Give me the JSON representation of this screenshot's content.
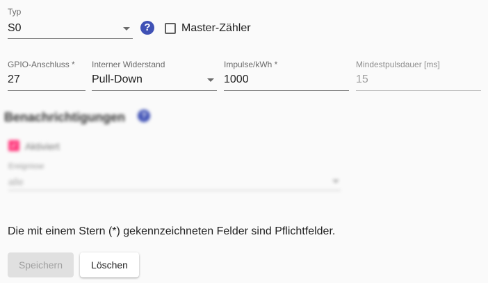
{
  "typ": {
    "label": "Typ",
    "value": "S0"
  },
  "help_icon": "?",
  "master": {
    "label": "Master-Zähler",
    "checked": false
  },
  "gpio": {
    "label": "GPIO-Anschluss *",
    "value": "27"
  },
  "widerstand": {
    "label": "Interner Widerstand",
    "value": "Pull-Down"
  },
  "impulse": {
    "label": "Impulse/kWh *",
    "value": "1000"
  },
  "mindest": {
    "label": "Mindestpulsdauer [ms]",
    "value": "15"
  },
  "notifications": {
    "heading": "Benachrichtigungen",
    "aktiviert_label": "Aktiviert",
    "aktiviert_checked": true,
    "check_glyph": "✓",
    "ereignisse_label": "Ereignisse",
    "ereignisse_value": "alle"
  },
  "required_note": "Die mit einem Stern (*) gekennzeichneten Felder sind Pflichtfelder.",
  "buttons": {
    "save": "Speichern",
    "delete": "Löschen"
  },
  "colors": {
    "accent": "#3f51b5",
    "checkbox_pink": "#ff4081"
  }
}
